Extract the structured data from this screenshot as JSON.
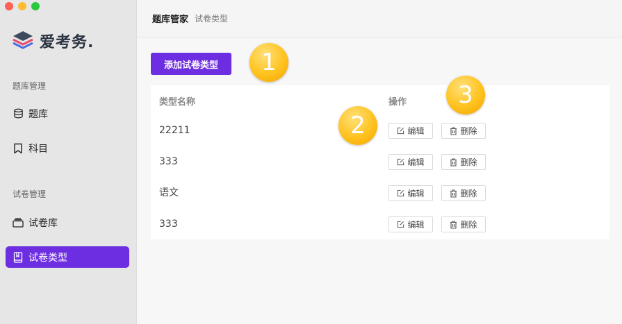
{
  "window": {
    "controls": [
      "close",
      "minimize",
      "zoom"
    ]
  },
  "app": {
    "name": "爱考务."
  },
  "sidebar": {
    "section1_label": "题库管理",
    "section2_label": "试卷管理",
    "items": [
      {
        "label": "题库",
        "icon": "database-icon"
      },
      {
        "label": "科目",
        "icon": "bookmark-icon"
      },
      {
        "label": "试卷库",
        "icon": "stack-icon"
      },
      {
        "label": "试卷类型",
        "icon": "book-icon",
        "active": true
      }
    ]
  },
  "header": {
    "title": "题库管家",
    "subtitle": "试卷类型"
  },
  "actions": {
    "add_label": "添加试卷类型"
  },
  "table": {
    "headers": {
      "name": "类型名称",
      "ops": "操作"
    },
    "edit_label": "编辑",
    "delete_label": "删除",
    "rows": [
      {
        "name": "22211"
      },
      {
        "name": "333"
      },
      {
        "name": "语文"
      },
      {
        "name": "333"
      }
    ]
  },
  "callouts": [
    "1",
    "2",
    "3"
  ],
  "colors": {
    "accent": "#6d2de0",
    "badge": "#ffc21e"
  }
}
